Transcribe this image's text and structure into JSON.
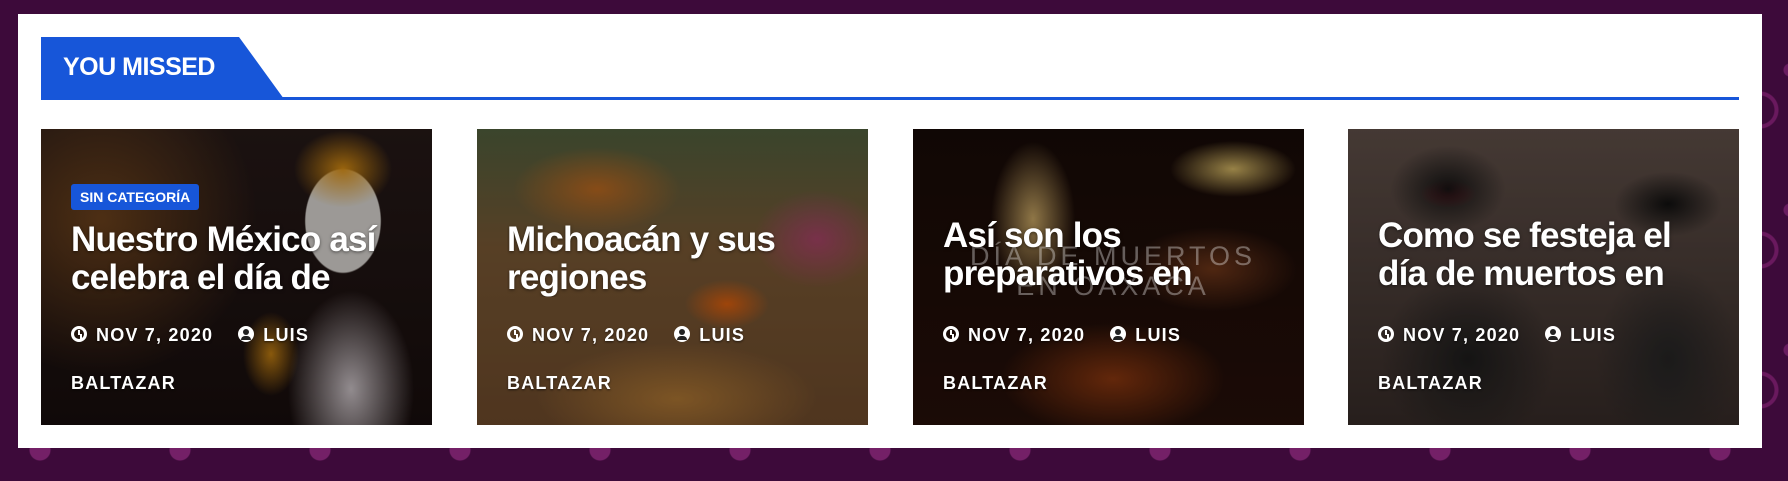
{
  "section": {
    "title": "YOU MISSED"
  },
  "colors": {
    "accent": "#1756d9",
    "page_bg": "#3d0a3a"
  },
  "cards": [
    {
      "category": "SIN CATEGORÍA",
      "title": "Nuestro México así celebra el día de",
      "date": "NOV 7, 2020",
      "author": "LUIS BALTAZAR",
      "date_icon": "clock-icon",
      "author_icon": "user-circle-icon"
    },
    {
      "title": "Michoacán y sus regiones",
      "date": "NOV 7, 2020",
      "author": "LUIS BALTAZAR",
      "date_icon": "clock-icon",
      "author_icon": "user-circle-icon"
    },
    {
      "title": "Así son los preparativos en",
      "image_text": "DÍA DE MUERTOS EN OAXACA",
      "date": "NOV 7, 2020",
      "author": "LUIS BALTAZAR",
      "date_icon": "clock-icon",
      "author_icon": "user-circle-icon"
    },
    {
      "title": "Como se festeja el día de muertos en",
      "date": "NOV 7, 2020",
      "author": "LUIS BALTAZAR",
      "date_icon": "clock-icon",
      "author_icon": "user-circle-icon"
    }
  ]
}
